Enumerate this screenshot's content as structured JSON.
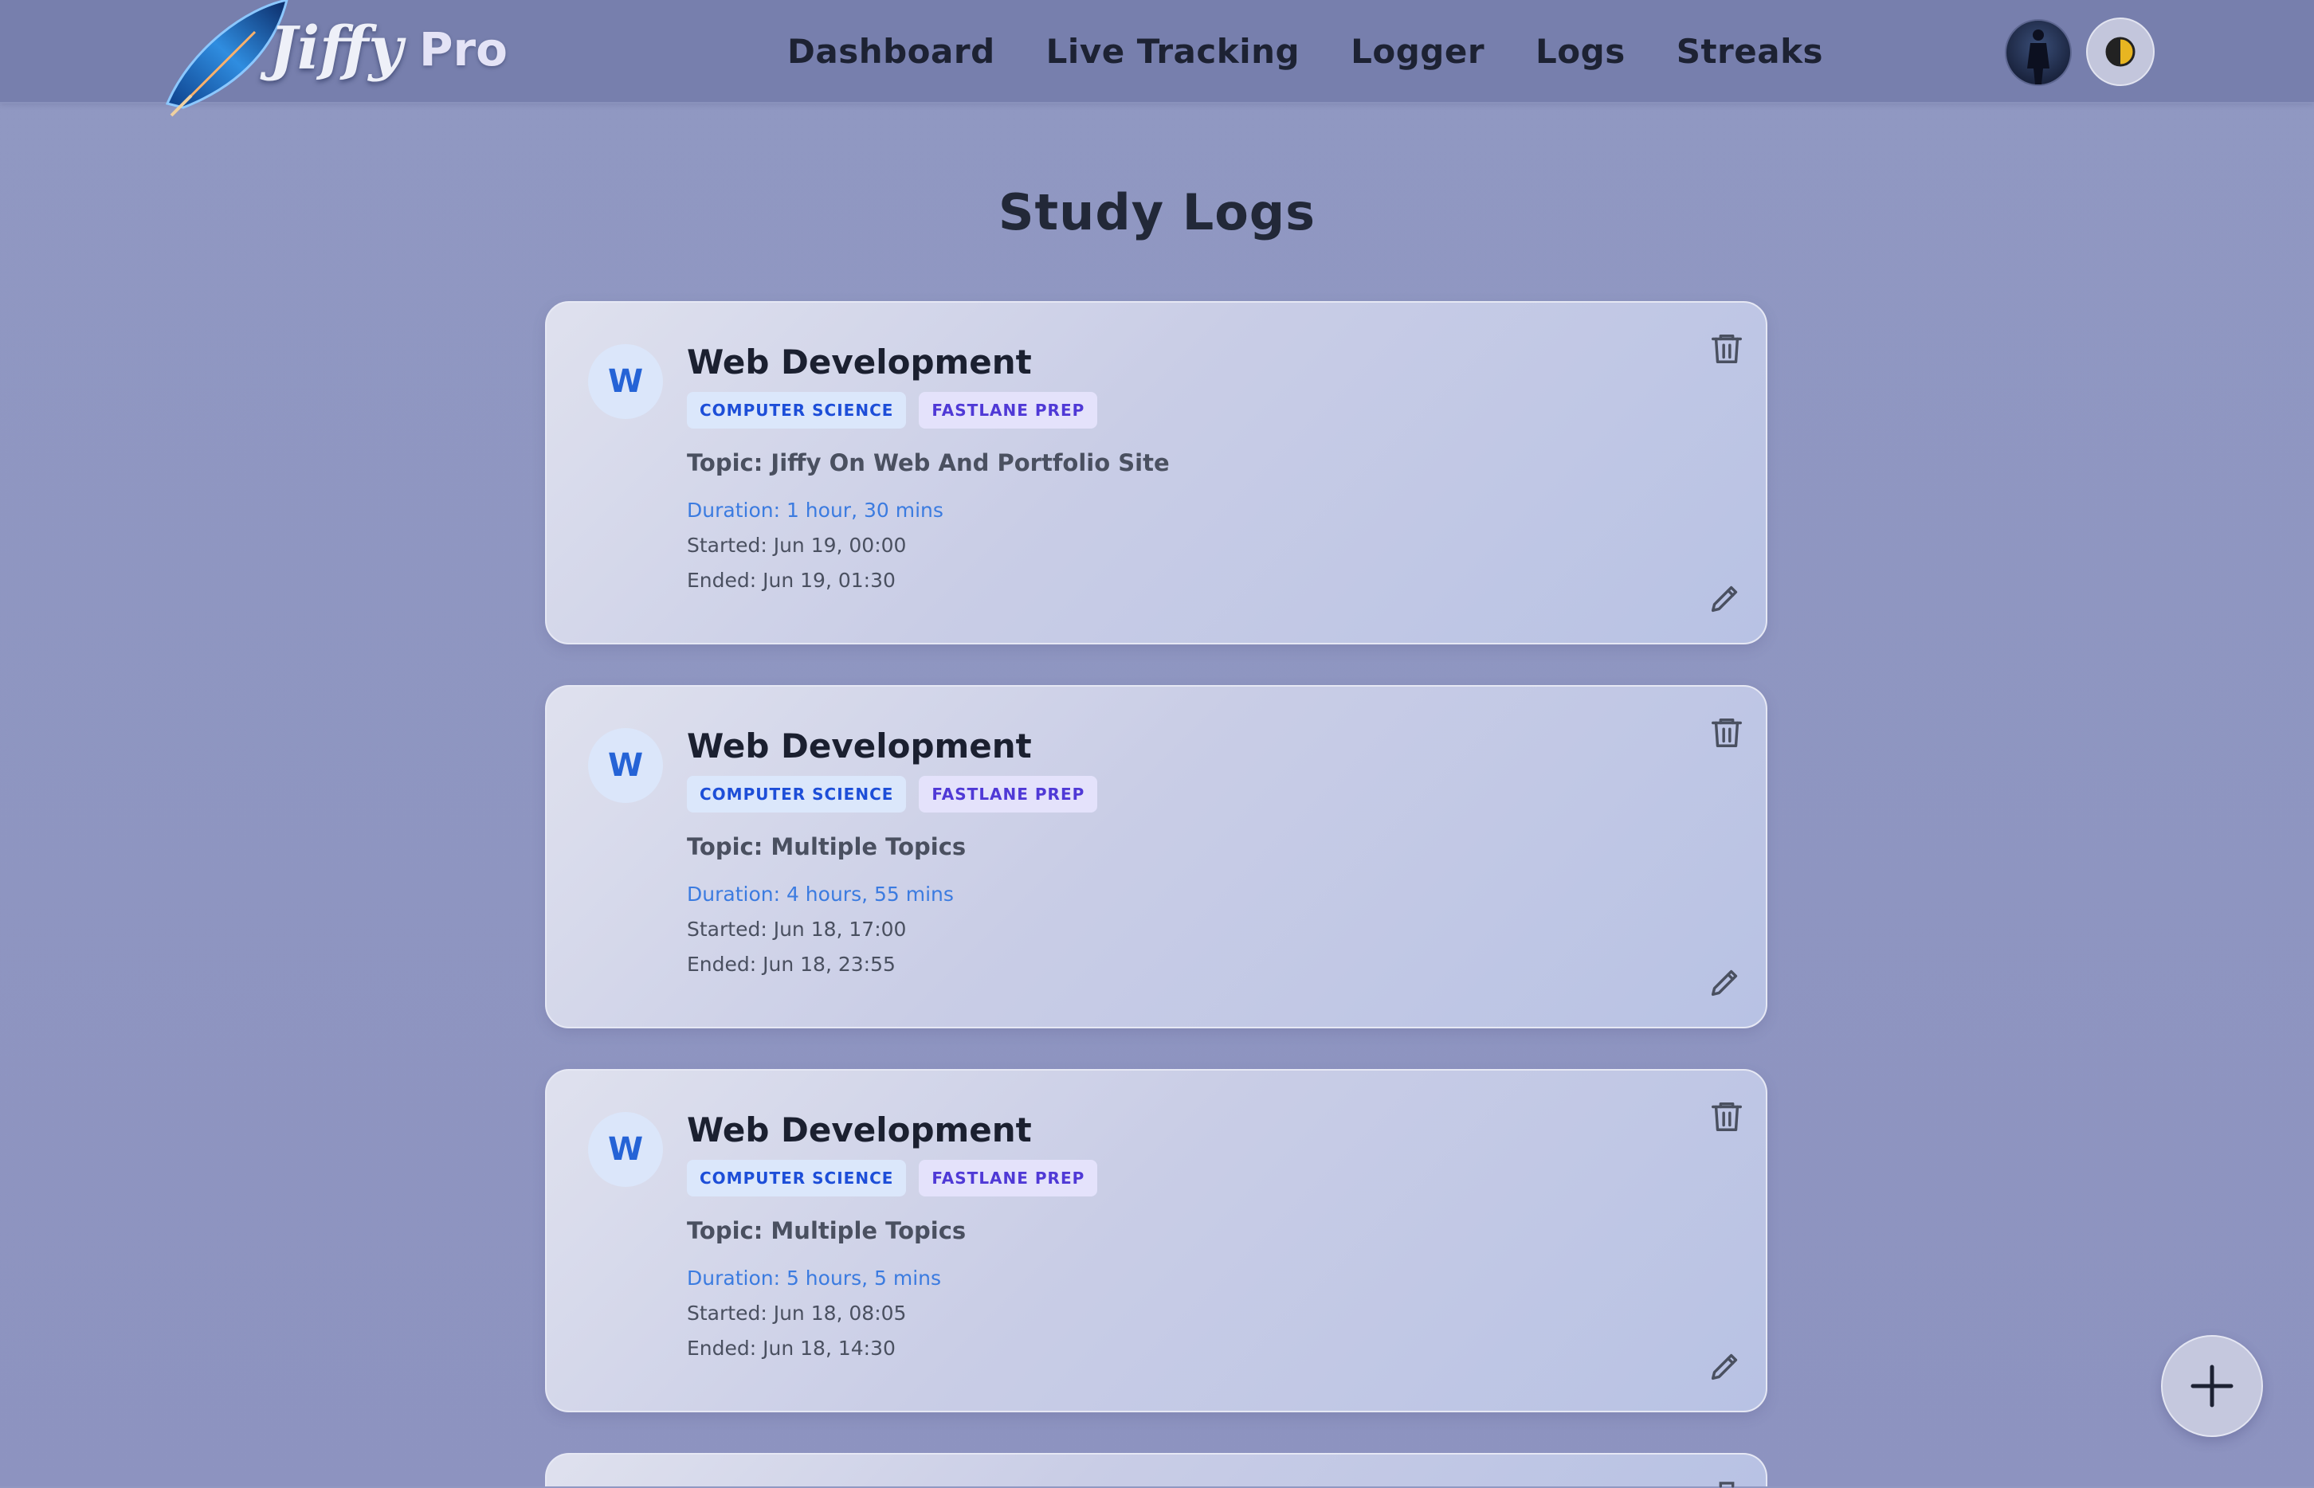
{
  "brand": {
    "name": "Jiffy",
    "tier": "Pro"
  },
  "nav": {
    "items": [
      {
        "label": "Dashboard"
      },
      {
        "label": "Live Tracking"
      },
      {
        "label": "Logger"
      },
      {
        "label": "Logs"
      },
      {
        "label": "Streaks"
      }
    ]
  },
  "page": {
    "title": "Study Logs"
  },
  "logs": [
    {
      "avatar_letter": "W",
      "subject": "Web Development",
      "tags": [
        "COMPUTER SCIENCE",
        "FASTLANE PREP"
      ],
      "topic": "Topic: Jiffy On Web And Portfolio Site",
      "duration": "Duration: 1 hour, 30 mins",
      "started": "Started: Jun 19, 00:00",
      "ended": "Ended: Jun 19, 01:30"
    },
    {
      "avatar_letter": "W",
      "subject": "Web Development",
      "tags": [
        "COMPUTER SCIENCE",
        "FASTLANE PREP"
      ],
      "topic": "Topic: Multiple Topics",
      "duration": "Duration: 4 hours, 55 mins",
      "started": "Started: Jun 18, 17:00",
      "ended": "Ended: Jun 18, 23:55"
    },
    {
      "avatar_letter": "W",
      "subject": "Web Development",
      "tags": [
        "COMPUTER SCIENCE",
        "FASTLANE PREP"
      ],
      "topic": "Topic: Multiple Topics",
      "duration": "Duration: 5 hours, 5 mins",
      "started": "Started: Jun 18, 08:05",
      "ended": "Ended: Jun 18, 14:30"
    }
  ],
  "icons": {
    "logo": "feather-icon",
    "theme": "half-moon-icon",
    "delete": "trash-icon",
    "edit": "pencil-icon",
    "add": "plus-icon"
  },
  "colors": {
    "accent": "#2563d6",
    "duration": "#3b7be0",
    "badge_cs": "#1d4ed8",
    "badge_fp": "#4f39d6",
    "topbar": "#777fad",
    "background": "#8d93c0"
  }
}
